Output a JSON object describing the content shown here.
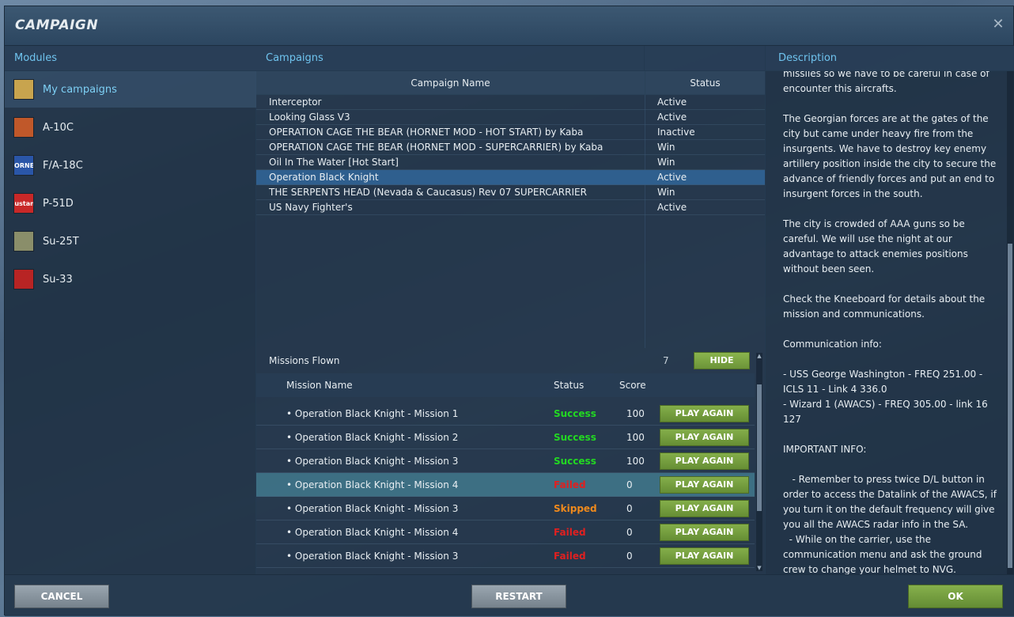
{
  "window": {
    "title": "CAMPAIGN",
    "close_glyph": "✕"
  },
  "columns": {
    "modules": "Modules",
    "campaigns": "Campaigns",
    "description": "Description"
  },
  "modules": {
    "items": [
      {
        "label": "My campaigns",
        "icon": "my-campaigns-icon",
        "icon_text": "",
        "color": "#c8a44e",
        "selected": true
      },
      {
        "label": "A-10C",
        "icon": "a10c-icon",
        "icon_text": "",
        "color": "#c0582a",
        "selected": false
      },
      {
        "label": "F/A-18C",
        "icon": "fa18c-hornet-icon",
        "icon_text": "HORNET",
        "color": "#2a56a8",
        "selected": false
      },
      {
        "label": "P-51D",
        "icon": "p51d-mustang-icon",
        "icon_text": "Mustang",
        "color": "#c82828",
        "selected": false
      },
      {
        "label": "Su-25T",
        "icon": "su25t-icon",
        "icon_text": "",
        "color": "#8a8e6a",
        "selected": false
      },
      {
        "label": "Su-33",
        "icon": "su33-icon",
        "icon_text": "",
        "color": "#b82424",
        "selected": false
      }
    ]
  },
  "campaigns": {
    "header_name": "Campaign Name",
    "header_status": "Status",
    "rows": [
      {
        "name": "Interceptor",
        "status": "Active",
        "selected": false
      },
      {
        "name": "Looking Glass V3",
        "status": "Active",
        "selected": false
      },
      {
        "name": "OPERATION CAGE THE BEAR (HORNET MOD - HOT START) by Kaba",
        "status": "Inactive",
        "selected": false
      },
      {
        "name": "OPERATION CAGE THE BEAR (HORNET MOD - SUPERCARRIER) by Kaba",
        "status": "Win",
        "selected": false
      },
      {
        "name": "Oil In The Water [Hot Start]",
        "status": "Win",
        "selected": false
      },
      {
        "name": "Operation Black Knight",
        "status": "Active",
        "selected": true
      },
      {
        "name": "THE SERPENTS HEAD (Nevada & Caucasus) Rev 07 SUPERCARRIER",
        "status": "Win",
        "selected": false
      },
      {
        "name": "US Navy Fighter's",
        "status": "Active",
        "selected": false
      }
    ]
  },
  "missions": {
    "label": "Missions Flown",
    "count": "7",
    "hide_label": "HIDE",
    "header_name": "Mission Name",
    "header_status": "Status",
    "header_score": "Score",
    "play_again_label": "PLAY AGAIN",
    "status_colors": {
      "Success": "#22d822",
      "Failed": "#e02020",
      "Skipped": "#f08a1c"
    },
    "rows": [
      {
        "name": "• Operation Black Knight - Mission 1",
        "status": "Success",
        "score": "100",
        "selected": false
      },
      {
        "name": "• Operation Black Knight - Mission 2",
        "status": "Success",
        "score": "100",
        "selected": false
      },
      {
        "name": "• Operation Black Knight - Mission 3",
        "status": "Success",
        "score": "100",
        "selected": false
      },
      {
        "name": "• Operation Black Knight - Mission 4",
        "status": "Failed",
        "score": "0",
        "selected": true
      },
      {
        "name": "• Operation Black Knight - Mission 3",
        "status": "Skipped",
        "score": "0",
        "selected": false
      },
      {
        "name": "• Operation Black Knight - Mission 4",
        "status": "Failed",
        "score": "0",
        "selected": false
      },
      {
        "name": "• Operation Black Knight - Mission 3",
        "status": "Failed",
        "score": "0",
        "selected": false
      }
    ]
  },
  "description": {
    "text": "missiles so we have to be careful in case of\nencounter this aircrafts.\n\nThe Georgian forces are at the gates of the city but came under heavy fire from the insurgents. We have to destroy key enemy artillery position inside the city to secure the advance of friendly forces and put an end to insurgent forces in the south.\n\nThe city is crowded of AAA guns so be careful. We will use the night at our advantage to attack enemies positions without been seen.\n\nCheck the Kneeboard for details about the mission and communications.\n\nCommunication info:\n\n- USS George Washington - FREQ 251.00 - ICLS 11 - Link 4 336.0\n- Wizard 1 (AWACS) - FREQ 305.00 - link 16 127\n\nIMPORTANT INFO:\n\n   - Remember to press twice D/L button in order to access the Datalink of the AWACS, if you turn it on the default frequency will give you all the AWACS radar info in the SA.\n  - While on the carrier, use the communication menu and ask the ground crew to change your helmet to NVG."
  },
  "footer": {
    "cancel_label": "CANCEL",
    "restart_label": "RESTART",
    "ok_label": "OK"
  }
}
